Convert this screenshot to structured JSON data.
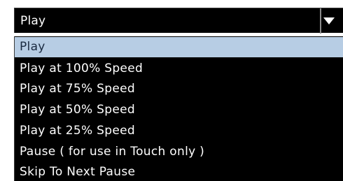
{
  "select": {
    "value": "Play",
    "arrow_icon": "triangle-down-icon"
  },
  "dropdown": {
    "options": [
      {
        "label": "Play",
        "selected": true
      },
      {
        "label": "Play at 100% Speed",
        "selected": false
      },
      {
        "label": "Play at 75% Speed",
        "selected": false
      },
      {
        "label": "Play at 50% Speed",
        "selected": false
      },
      {
        "label": "Play at 25% Speed",
        "selected": false
      },
      {
        "label": "Pause ( for use in Touch only )",
        "selected": false
      },
      {
        "label": "Skip To Next Pause",
        "selected": false
      }
    ]
  },
  "colors": {
    "background": "#000000",
    "text": "#ffffff",
    "highlight": "#b7cde4"
  }
}
